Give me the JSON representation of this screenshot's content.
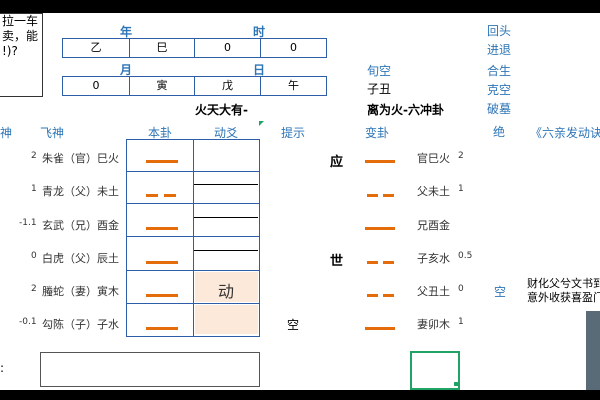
{
  "note_lines": [
    "拉一车",
    "卖，能",
    "!)?"
  ],
  "header": {
    "year_label": "年",
    "hour_label": "时",
    "month_label": "月",
    "day_label": "日"
  },
  "row1": [
    "乙",
    "巳",
    "0",
    "0"
  ],
  "row2": [
    "0",
    "寅",
    "戊",
    "午"
  ],
  "right_list": [
    "回头",
    "进退",
    "合生",
    "克空",
    "破墓",
    "绝"
  ],
  "xunkong": {
    "label": "旬空",
    "value": "子丑"
  },
  "gua": {
    "main_name": "火天大有-",
    "change_name": "离为火-六冲卦"
  },
  "columns": {
    "shen": "神",
    "feishen": "飞神",
    "bengua": "本卦",
    "dongyao": "动爻",
    "tishi": "提示",
    "biangua": "变卦",
    "book": "《六亲发动诀"
  },
  "left_rows": [
    {
      "num": "2",
      "text": "朱雀（官）巳火"
    },
    {
      "num": "1",
      "text": "青龙（父）未土"
    },
    {
      "num": "-1.1",
      "text": "玄武（兄）酉金"
    },
    {
      "num": "0",
      "text": "白虎（父）辰土"
    },
    {
      "num": "2",
      "text": "螣蛇（妻）寅木"
    },
    {
      "num": "-0.1",
      "text": "勾陈（子）子水"
    }
  ],
  "ben_lines": [
    "yang",
    "yin",
    "yang",
    "yang",
    "yang",
    "yang"
  ],
  "dong_label": "动",
  "shiying": {
    "ying": "应",
    "shi": "世"
  },
  "kong_mark": "空",
  "bian_lines": [
    "yang",
    "yin",
    "yang",
    "yin",
    "yin",
    "yang"
  ],
  "right_rows": [
    {
      "text": "官巳火",
      "num": "2"
    },
    {
      "text": "父未土",
      "num": "1"
    },
    {
      "text": "兄酉金",
      "num": ""
    },
    {
      "text": "子亥水",
      "num": "0.5"
    },
    {
      "text": "父丑土",
      "num": "0"
    },
    {
      "text": "妻卯木",
      "num": "1"
    }
  ],
  "kong2": "空",
  "right_note": [
    "财化父兮文书到",
    "意外收获喜盈门"
  ],
  "colors": {
    "orange": "#e46c0a",
    "blue": "#2e75b6",
    "cell_border": "#2e5ea8",
    "highlight": "#fde9d9",
    "selection": "#21a366"
  }
}
